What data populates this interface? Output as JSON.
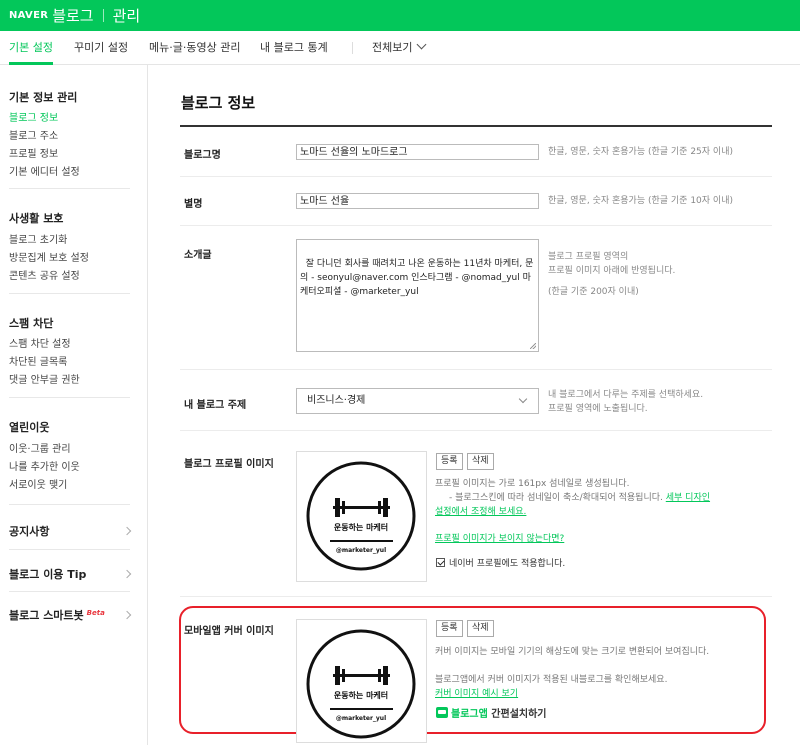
{
  "header": {
    "naver_logo": "NAVER",
    "blog_label": "블로그",
    "manage_label": "관리"
  },
  "tabs": [
    {
      "label": "기본 설정"
    },
    {
      "label": "꾸미기 설정"
    },
    {
      "label": "메뉴·글·동영상 관리"
    },
    {
      "label": "내 블로그 통계"
    },
    {
      "label": "전체보기"
    }
  ],
  "sidebar": {
    "sections": [
      {
        "title": "기본 정보 관리",
        "items": [
          "블로그 정보",
          "블로그 주소",
          "프로필 정보",
          "기본 에디터 설정"
        ]
      },
      {
        "title": "사생활 보호",
        "items": [
          "블로그 초기화",
          "방문집계 보호 설정",
          "콘텐츠 공유 설정"
        ]
      },
      {
        "title": "스팸 차단",
        "items": [
          "스팸 차단 설정",
          "차단된 글목록",
          "댓글 안부글 권한"
        ]
      },
      {
        "title": "열린이웃",
        "items": [
          "이웃·그룹 관리",
          "나를 추가한 이웃",
          "서로이웃 맺기"
        ]
      }
    ],
    "links": [
      {
        "label": "공지사항"
      },
      {
        "label": "블로그 이용 Tip"
      },
      {
        "label": "블로그 스마트봇",
        "badge": "Beta"
      }
    ]
  },
  "main": {
    "title": "블로그 정보",
    "blog_name": {
      "label": "블로그명",
      "value": "노마드 선율의 노마드로그",
      "hint": "한글, 영문, 숫자 혼용가능 (한글 기준 25자 이내)"
    },
    "nickname": {
      "label": "별명",
      "value": "노마드 선율",
      "hint": "한글, 영문, 숫자 혼용가능 (한글 기준 10자 이내)"
    },
    "intro": {
      "label": "소개글",
      "value": "잘 다니던 회사를 때려치고 나온 운동하는 11년차 마케터, 문의 - seonyul@naver.com 인스타그램 - @nomad_yul 마케터오피셜 - @marketer_yul",
      "hint1": "블로그 프로필 영역의",
      "hint2": "프로필 이미지 아래에 반영됩니다.",
      "hint3": "(한글 기준 200자 이내)"
    },
    "topic": {
      "label": "내 블로그 주제",
      "value": "비즈니스·경제",
      "hint1": "내 블로그에서 다루는 주제를 선택하세요.",
      "hint2": "프로필 영역에 노출됩니다."
    },
    "profile_image": {
      "label": "블로그 프로필 이미지",
      "register": "등록",
      "delete": "삭제",
      "logo_text": "운동하는 마케터",
      "logo_handle": "@marketer_yul",
      "desc1": "프로필 이미지는 가로 161px 섬네일로 생성됩니다.",
      "desc2": "- 블로그스킨에 따라 섬네일이 축소/확대되어 적용됩니다.",
      "desc2_link": "세부 디자인",
      "desc3_link": "설정에서 조정해 보세요.",
      "help_link": "프로필 이미지가 보이지 않는다면?",
      "checkbox_label": "네이버 프로필에도 적용합니다."
    },
    "cover_image": {
      "label": "모바일앱 커버 이미지",
      "register": "등록",
      "delete": "삭제",
      "logo_text": "운동하는 마케터",
      "logo_handle": "@marketer_yul",
      "desc1": "커버 이미지는 모바일 기기의 해상도에 맞는 크기로 변환되어 보여집니다.",
      "desc2": "블로그앱에서 커버 이미지가 적용된 내블로그를 확인해보세요.",
      "example_link": "커버 이미지 예시 보기",
      "app_name": "블로그앱",
      "app_install": "간편설치하기"
    }
  },
  "colors": {
    "brand": "#03c75a",
    "highlight": "#e8202a"
  }
}
